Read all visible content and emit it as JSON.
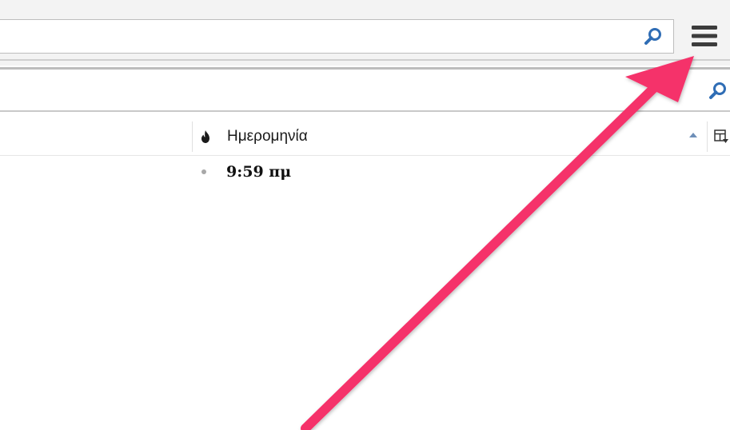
{
  "toolbar": {
    "search": {
      "value": "",
      "placeholder": "",
      "icon": "search-icon"
    },
    "menu": {
      "icon": "hamburger-menu-icon"
    }
  },
  "quick_search": {
    "value": "",
    "placeholder": "",
    "icon": "search-icon"
  },
  "message_list": {
    "columns": [
      {
        "id": "junk",
        "icon": "junk-flame-icon",
        "label": ""
      },
      {
        "id": "date",
        "label": "Ημερομηνία",
        "sort": "ascending"
      }
    ],
    "rows": [
      {
        "status": "dot",
        "date": "9:59 πμ"
      }
    ]
  },
  "annotation": {
    "type": "arrow",
    "color": "#f5336b",
    "points_to": "hamburger-menu-icon"
  },
  "colors": {
    "search_icon": "#2f6db5",
    "menu_icon": "#3c3c3c",
    "sort_arrow": "#6e8fb8",
    "arrow": "#f5336b"
  }
}
